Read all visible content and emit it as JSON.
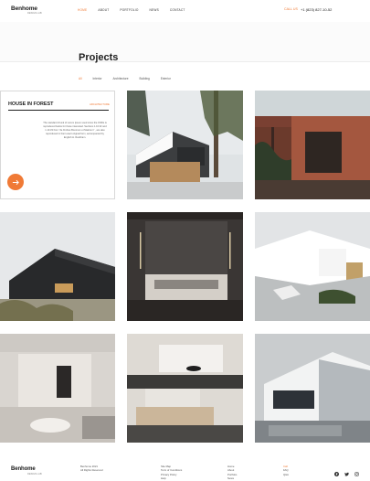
{
  "header": {
    "logo": "Benhome",
    "logo_sub": "DESIGN LAB",
    "nav": [
      "HOME",
      "ABOUT",
      "PORTFOLIO",
      "NEWS",
      "CONTACT"
    ],
    "active_nav": "HOME",
    "call_label": "CALL US",
    "phone": "+1 (823) 827-10-52"
  },
  "page": {
    "title": "Projects"
  },
  "filters": [
    "All",
    "Interior",
    "Architecture",
    "Building",
    "Exterior"
  ],
  "feature": {
    "title": "HOUSE IN FOREST",
    "tag": "ARCHITECTURE",
    "description": "The standard chunk of Lorem Ipsum used since the 1500s is reproduced below for those interested. Sections 1.10.32 and 1.10.33 from \"de Finibus Bonorum et Malorum\" , are also reproduced in their exact original form, accompanied by English H. Rackham."
  },
  "footer": {
    "logo": "Benhome",
    "logo_sub": "DESIGN LAB",
    "copy_lines": [
      "Benhome 2021",
      "All Rights Reserved"
    ],
    "legal_links": [
      "Site Map",
      "Term of Conditions",
      "Privacy Policy",
      "Help"
    ],
    "nav_links": [
      "Home",
      "About",
      "Portfolio",
      "News"
    ],
    "extra_links": [
      "Call",
      "FAQ",
      "Q&A"
    ],
    "social_icons": [
      "facebook-icon",
      "twitter-icon",
      "instagram-icon"
    ]
  },
  "colors": {
    "accent": "#f07a36",
    "text": "#1b1b1b",
    "muted": "#666666"
  }
}
